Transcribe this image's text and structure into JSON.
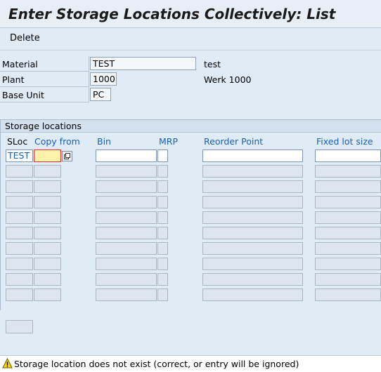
{
  "title": "Enter Storage Locations Collectively: List",
  "toolbar": {
    "delete_label": "Delete"
  },
  "header": {
    "material_label": "Material",
    "material_value": "TEST",
    "material_desc": "test",
    "plant_label": "Plant",
    "plant_value": "1000",
    "plant_desc": "Werk 1000",
    "base_unit_label": "Base Unit",
    "base_unit_value": "PC"
  },
  "storage": {
    "group_title": "Storage locations",
    "columns": {
      "sloc": "SLoc",
      "copy_from": "Copy from",
      "bin": "Bin",
      "mrp": "MRP",
      "reorder_point": "Reorder Point",
      "fixed_lot_size": "Fixed lot size"
    },
    "rows": [
      {
        "sloc": "TEST",
        "copy_from": "",
        "bin": "",
        "mrp": "",
        "reorder_point": "",
        "fixed_lot_size": ""
      }
    ]
  },
  "status": {
    "icon": "warning-icon",
    "message": "Storage location does not exist (correct, or entry will be ignored)"
  }
}
